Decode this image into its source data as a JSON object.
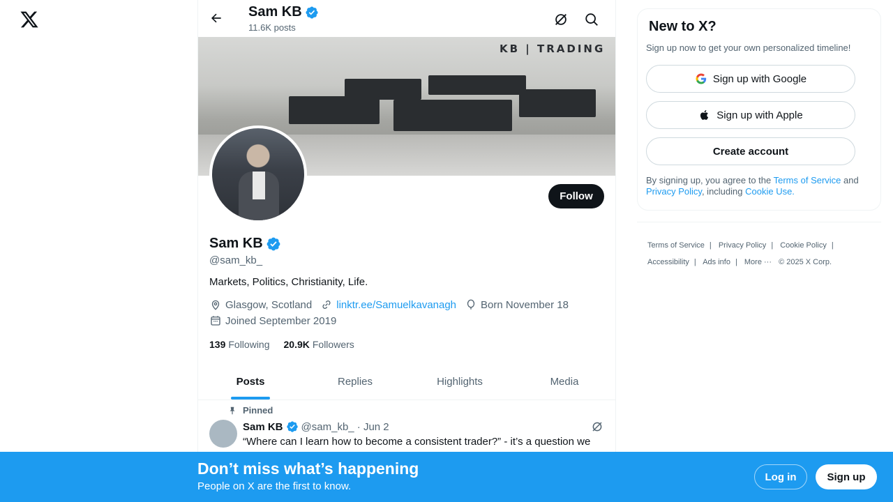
{
  "app": {
    "logo_icon": "x-logo-icon"
  },
  "topbar": {
    "name": "Sam KB",
    "posts_count": "11.6K posts",
    "back_icon": "arrow-left-icon",
    "grok_icon": "grok-icon",
    "search_icon": "search-icon"
  },
  "banner": {
    "brand_text": "KB | TRADING"
  },
  "profile": {
    "name": "Sam KB",
    "handle": "@sam_kb_",
    "bio": "Markets, Politics, Christianity, Life.",
    "location": "Glasgow, Scotland",
    "link": "linktr.ee/Samuelkavanagh",
    "birthday": "Born November 18",
    "joined": "Joined September 2019",
    "following_count": "139",
    "following_label": "Following",
    "followers_count": "20.9K",
    "followers_label": "Followers",
    "follow_label": "Follow"
  },
  "tabs": [
    {
      "label": "Posts",
      "active": true
    },
    {
      "label": "Replies",
      "active": false
    },
    {
      "label": "Highlights",
      "active": false
    },
    {
      "label": "Media",
      "active": false
    }
  ],
  "tweet": {
    "pinned_label": "Pinned",
    "author": "Sam KB",
    "handle": "@sam_kb_",
    "date": "· Jun 2",
    "text": "“Where can I learn how to become a consistent trader?” - it’s a question we"
  },
  "sidebar": {
    "title": "New to X?",
    "subtitle": "Sign up now to get your own personalized timeline!",
    "google_label": "Sign up with Google",
    "apple_label": "Sign up with Apple",
    "create_label": "Create account",
    "legal": {
      "pre": "By signing up, you agree to the ",
      "tos": "Terms of Service",
      "and": " and ",
      "privacy": "Privacy Policy",
      "including": ", including ",
      "cookie": "Cookie Use."
    }
  },
  "footer": {
    "links": [
      "Terms of Service",
      "Privacy Policy",
      "Cookie Policy",
      "Accessibility",
      "Ads info"
    ],
    "more": "More ···",
    "copyright": "© 2025 X Corp."
  },
  "bottom_bar": {
    "title": "Don’t miss what’s happening",
    "subtitle": "People on X are the first to know.",
    "login": "Log in",
    "signup": "Sign up"
  },
  "colors": {
    "accent": "#1d9bf0",
    "text": "#0f1419",
    "muted": "#536471"
  }
}
